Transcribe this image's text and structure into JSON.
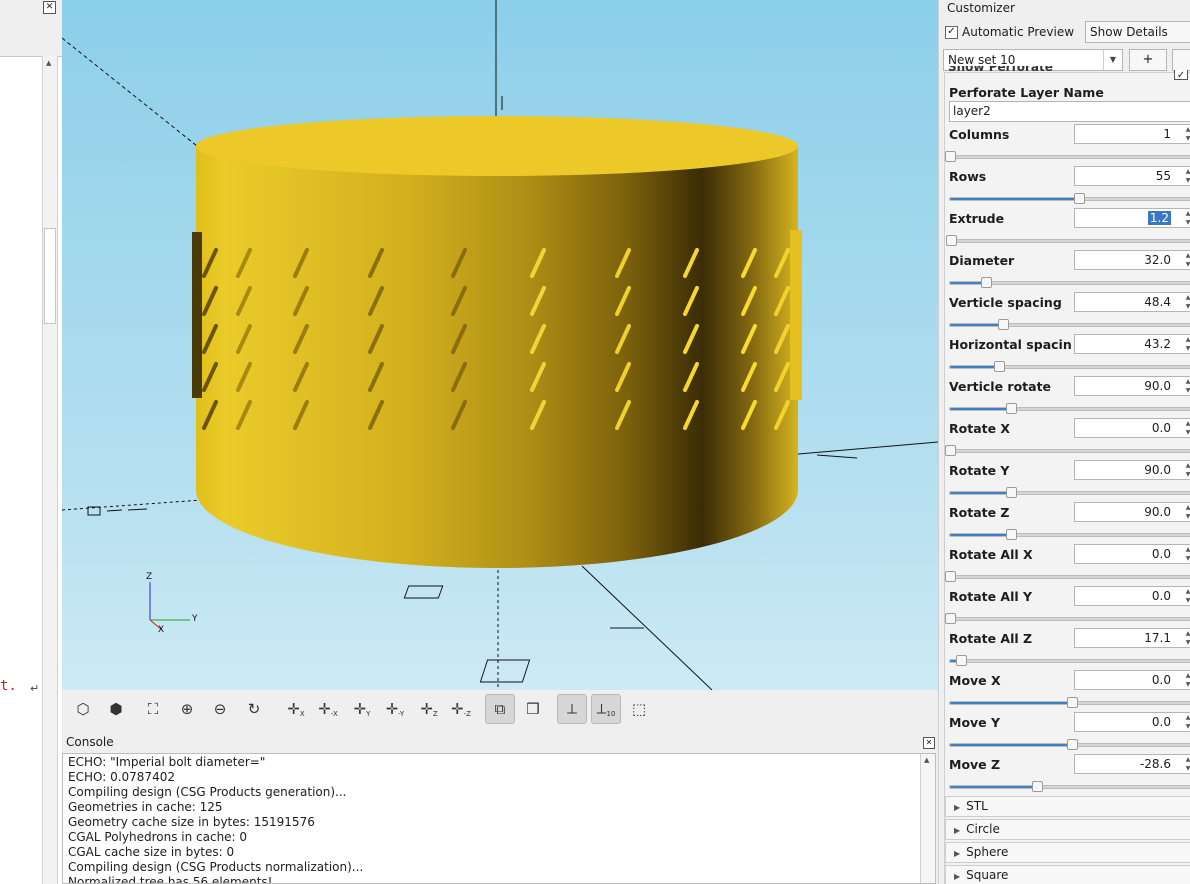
{
  "editor": {
    "code_fragment": "t.",
    "close_glyph": "✕"
  },
  "viewport": {
    "axis_label_z": "Z",
    "axis_label_y": "Y",
    "axis_label_x": "X"
  },
  "toolbar": {
    "buttons": [
      "view-all",
      "preview",
      "zoom-all",
      "zoom-in",
      "zoom-out",
      "reset-view",
      "view-right",
      "view-left",
      "view-back",
      "view-front",
      "view-top",
      "view-bottom",
      "perspective",
      "orthogonal",
      "show-axes",
      "show-scale-markers",
      "show-edges"
    ]
  },
  "console": {
    "title": "Console",
    "lines": [
      "ECHO: \"Imperial bolt diameter=\"",
      "ECHO: 0.0787402",
      "Compiling design (CSG Products generation)...",
      "Geometries in cache: 125",
      "Geometry cache size in bytes: 15191576",
      "CGAL Polyhedrons in cache: 0",
      "CGAL cache size in bytes: 0",
      "Compiling design (CSG Products normalization)...",
      "Normalized tree has 56 elements!"
    ]
  },
  "customizer": {
    "title": "Customizer",
    "auto_preview_label": "Automatic Preview",
    "auto_preview_checked": true,
    "show_details_label": "Show Details",
    "preset_name": "New set 10",
    "add_label": "+",
    "clipped_label": "Show Perforate",
    "layer_name_label": "Perforate Layer Name",
    "layer_name_value": "layer2",
    "params": [
      {
        "label": "Columns",
        "value": "1",
        "level": 0.0
      },
      {
        "label": "Rows",
        "value": "55",
        "level": 0.53
      },
      {
        "label": "Extrude",
        "value": "1.2",
        "level": 0.005,
        "selected": true
      },
      {
        "label": "Diameter",
        "value": "32.0",
        "level": 0.15
      },
      {
        "label": "Verticle spacing",
        "value": "48.4",
        "level": 0.22
      },
      {
        "label": "Horizontal spacing",
        "value": "43.2",
        "level": 0.2
      },
      {
        "label": "Verticle rotate",
        "value": "90.0",
        "level": 0.25
      },
      {
        "label": "Rotate X",
        "value": "0.0",
        "level": 0.0
      },
      {
        "label": "Rotate Y",
        "value": "90.0",
        "level": 0.25
      },
      {
        "label": "Rotate Z",
        "value": "90.0",
        "level": 0.25
      },
      {
        "label": "Rotate All X",
        "value": "0.0",
        "level": 0.0
      },
      {
        "label": "Rotate All Y",
        "value": "0.0",
        "level": 0.0
      },
      {
        "label": "Rotate All Z",
        "value": "17.1",
        "level": 0.047
      },
      {
        "label": "Move X",
        "value": "0.0",
        "level": 0.5
      },
      {
        "label": "Move Y",
        "value": "0.0",
        "level": 0.5
      },
      {
        "label": "Move Z",
        "value": "-28.6",
        "level": 0.357
      }
    ],
    "groups": [
      "STL",
      "Circle",
      "Sphere",
      "Square"
    ]
  }
}
